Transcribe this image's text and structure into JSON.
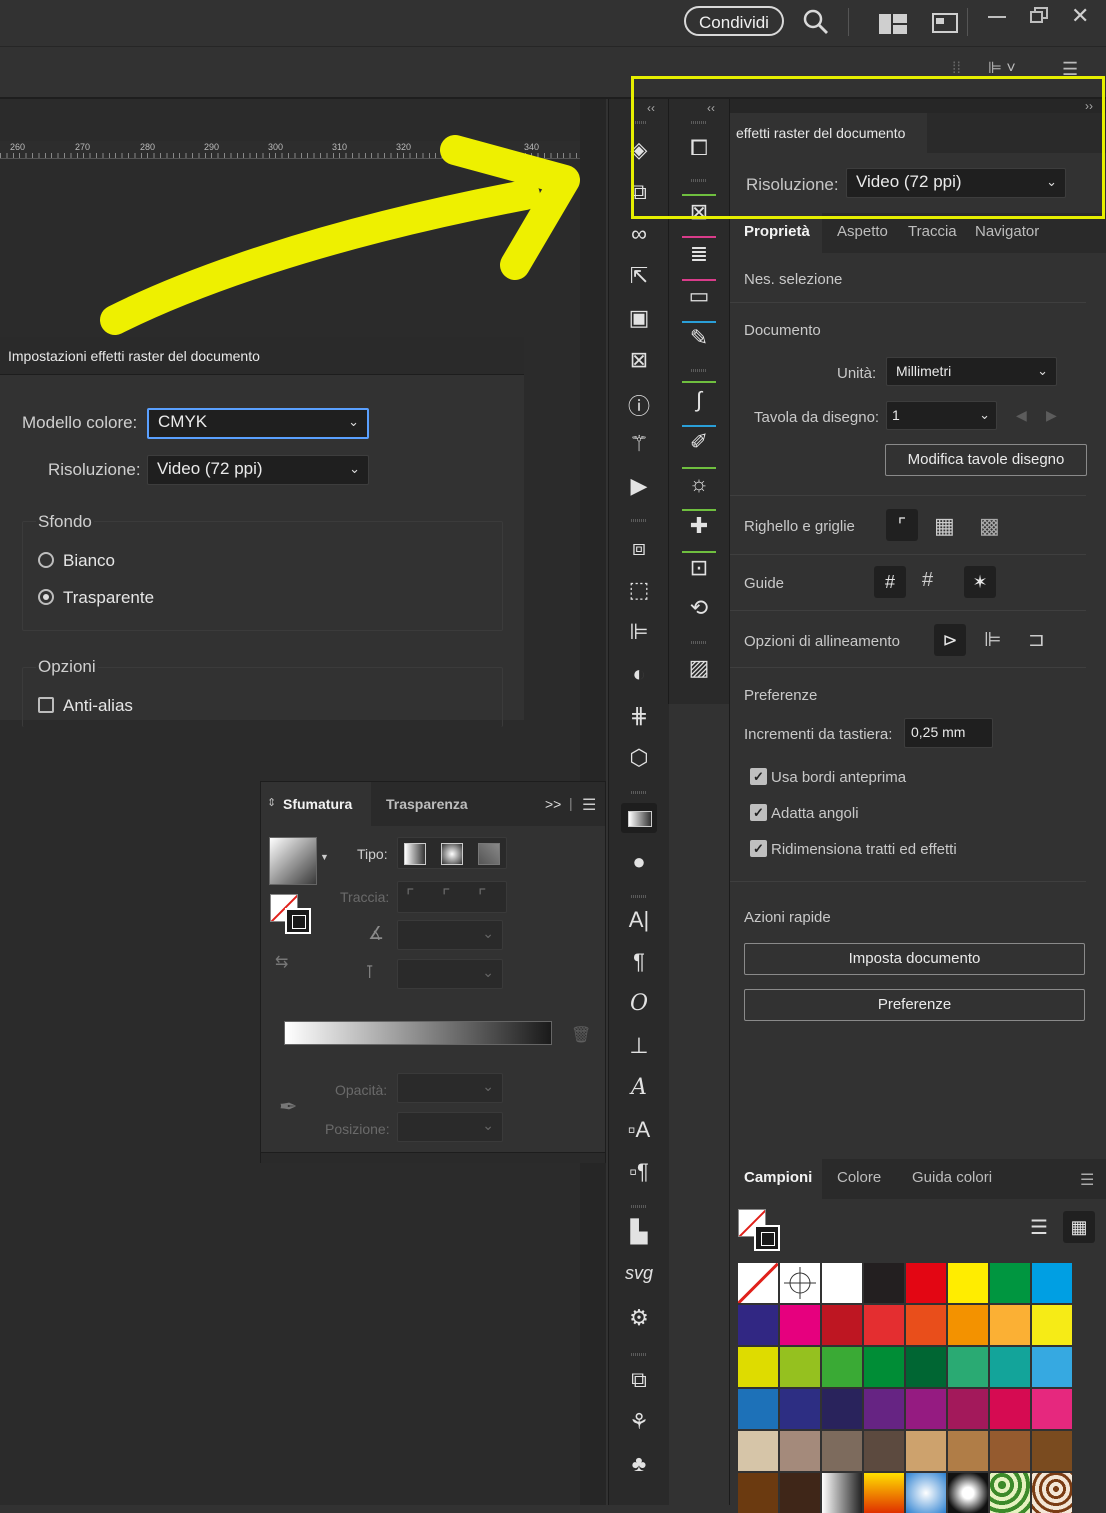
{
  "topbar": {
    "share_label": "Condividi"
  },
  "ruler": {
    "ticks": [
      "260",
      "270",
      "280",
      "290",
      "300",
      "310",
      "320",
      "340"
    ]
  },
  "dialog": {
    "title": "Impostazioni effetti raster del documento",
    "color_model_label": "Modello colore:",
    "color_model_value": "CMYK",
    "resolution_label": "Risoluzione:",
    "resolution_value": "Video (72 ppi)",
    "background_group": "Sfondo",
    "bg_white": "Bianco",
    "bg_transparent": "Trasparente",
    "options_group": "Opzioni",
    "antialias": "Anti-alias"
  },
  "raster_panel": {
    "tab_label": "effetti raster del documento",
    "resolution_label": "Risoluzione:",
    "resolution_value": "Video (72 ppi)"
  },
  "properties": {
    "tabs": [
      "Proprietà",
      "Aspetto",
      "Traccia",
      "Navigator"
    ],
    "no_selection": "Nes. selezione",
    "document_heading": "Documento",
    "units_label": "Unità:",
    "units_value": "Millimetri",
    "artboard_label": "Tavola da disegno:",
    "artboard_value": "1",
    "edit_artboards": "Modifica tavole disegno",
    "rulers_label": "Righello e griglie",
    "guides_label": "Guide",
    "align_options_label": "Opzioni di allineamento",
    "preferences_heading": "Preferenze",
    "keyboard_increment_label": "Incrementi da tastiera:",
    "keyboard_increment_value": "0,25 mm",
    "chk_preview_bounds": "Usa bordi anteprima",
    "chk_scale_corners": "Adatta angoli",
    "chk_scale_strokes": "Ridimensiona tratti ed effetti",
    "quick_actions_heading": "Azioni rapide",
    "btn_document_setup": "Imposta documento",
    "btn_preferences": "Preferenze"
  },
  "gradient_panel": {
    "tab_gradient": "Sfumatura",
    "tab_transparency": "Trasparenza",
    "type_label": "Tipo:",
    "stroke_label": "Traccia:",
    "opacity_label": "Opacità:",
    "position_label": "Posizione:"
  },
  "swatches_panel": {
    "tabs": [
      "Campioni",
      "Colore",
      "Guida colori"
    ],
    "swatch_colors": [
      [
        "none",
        "registration",
        "#ffffff",
        "#231f20",
        "#e30613",
        "#ffed00",
        "#009640",
        "#009fe3"
      ],
      [
        "#312783",
        "#e6007e",
        "#be1622",
        "#e42e30",
        "#e94e1b",
        "#f39200",
        "#fbb034",
        "#f6eb16"
      ],
      [
        "#dedc00",
        "#95c11f",
        "#3aaa35",
        "#008d36",
        "#006633",
        "#2aaa73",
        "#13a49a",
        "#36a9e1"
      ],
      [
        "#1d71b8",
        "#2d2e83",
        "#29235c",
        "#662483",
        "#951b81",
        "#a3195b",
        "#d60b52",
        "#e6287e"
      ],
      [
        "#d6c5a8",
        "#a48a7b",
        "#7d6b5d",
        "#5c4a3f",
        "#cda26d",
        "#b07d47",
        "#955b2f",
        "#7a4b1f"
      ],
      [
        "#6b3a10",
        "#3f2618",
        "gradient-gray",
        "gradient-warm",
        "gradient-blue",
        "gradient-radial",
        "pattern-leaf",
        "pattern-brown"
      ]
    ]
  },
  "colors": {
    "accent_yellow": "#e6ef00",
    "focus_blue": "#5aa0ff"
  },
  "icons": [
    "search-icon",
    "workspace-icon",
    "arrange-icon",
    "minimize-icon",
    "restore-icon",
    "close-icon",
    "layers-icon",
    "artboards-icon",
    "links-icon",
    "export-icon",
    "libraries-icon",
    "image-trace-icon",
    "info-icon",
    "magic-wand-icon",
    "actions-icon",
    "pathfinder-icon",
    "transform-icon",
    "align-icon",
    "recolor-icon",
    "variables-icon",
    "3d-icon",
    "gradient-icon",
    "transparency-icon",
    "character-icon",
    "paragraph-icon",
    "opentype-icon",
    "tabs-icon",
    "glyphs-icon",
    "character-styles-icon",
    "paragraph-styles-icon",
    "graph-icon",
    "svg-icon",
    "settings-icon"
  ]
}
